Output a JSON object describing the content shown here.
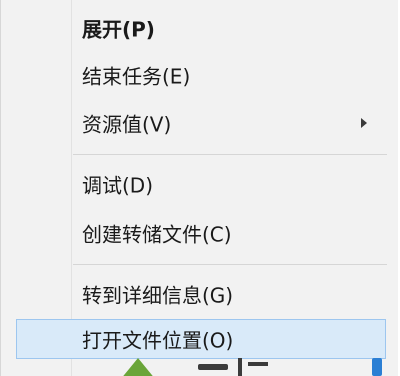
{
  "menu": {
    "items": [
      {
        "label": "展开(P)",
        "bold": true
      },
      {
        "label": "结束任务(E)"
      },
      {
        "label": "资源值(V)",
        "has_submenu": true
      },
      {
        "label": "调试(D)"
      },
      {
        "label": "创建转储文件(C)"
      },
      {
        "label": "转到详细信息(G)"
      },
      {
        "label": "打开文件位置(O)",
        "highlighted": true
      }
    ]
  },
  "colors": {
    "menu_background": "#f2f2f2",
    "highlight_background": "#d9eaf9",
    "highlight_border": "#9dc6ef",
    "separator": "#d6d6d6",
    "text": "#1a1a1a"
  },
  "icons": {
    "submenu": "chevron-right-icon",
    "watermark": "watermark-logo-icon"
  }
}
